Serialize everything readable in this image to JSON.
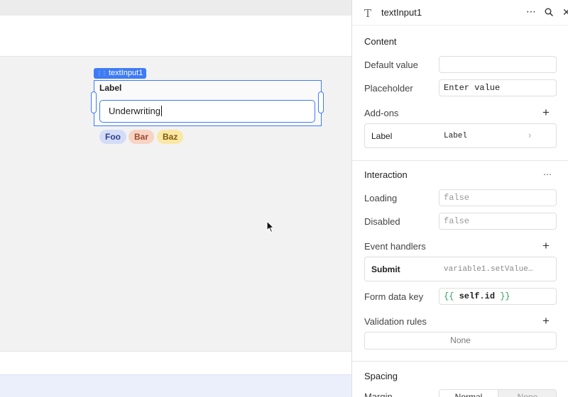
{
  "canvas": {
    "component_tag": "textInput1",
    "field": {
      "label": "Label",
      "value": "Underwriting"
    },
    "tags": [
      "Foo",
      "Bar",
      "Baz"
    ]
  },
  "inspector": {
    "header": {
      "type_icon": "T",
      "title": "textInput1",
      "more": "⋯",
      "close": "✕"
    },
    "content": {
      "title": "Content",
      "default_value": {
        "label": "Default value",
        "value": ""
      },
      "placeholder": {
        "label": "Placeholder",
        "value": "Enter value"
      },
      "addons": {
        "label": "Add-ons",
        "add": "+",
        "row": {
          "name": "Label",
          "value": "Label",
          "chevron": "›"
        }
      }
    },
    "interaction": {
      "title": "Interaction",
      "more": "⋯",
      "loading": {
        "label": "Loading",
        "value": "false"
      },
      "disabled": {
        "label": "Disabled",
        "value": "false"
      },
      "event_handlers": {
        "label": "Event handlers",
        "add": "+",
        "row": {
          "event": "Submit",
          "action": "variable1.setValue…"
        }
      },
      "form_data_key": {
        "label": "Form data key",
        "open": "{{",
        "expr": "self.id",
        "close": "}}"
      },
      "validation_rules": {
        "label": "Validation rules",
        "add": "+",
        "value": "None"
      }
    },
    "spacing": {
      "title": "Spacing",
      "margin": {
        "label": "Margin",
        "options": [
          "Normal",
          "None"
        ]
      }
    }
  },
  "colors": {
    "accent": "#3e7bf6",
    "code_brace": "#2e9e5b"
  }
}
